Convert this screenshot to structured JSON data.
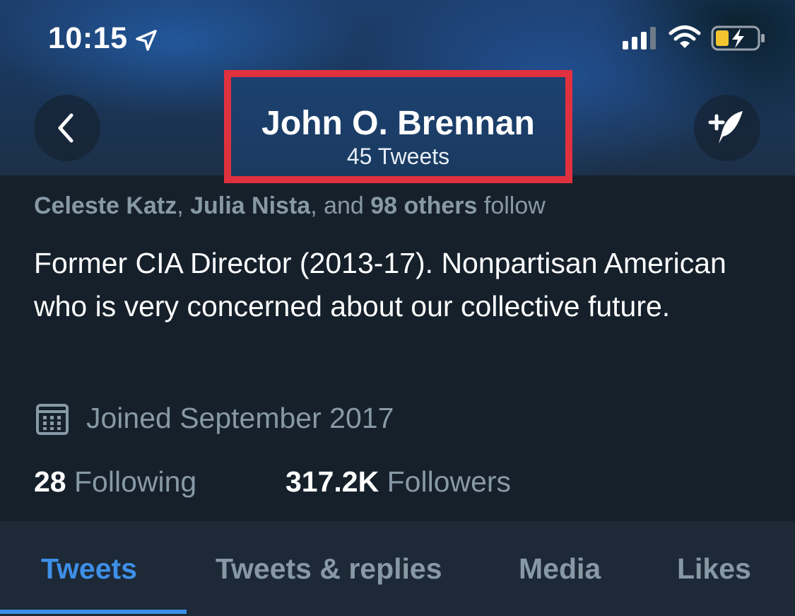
{
  "status_bar": {
    "time": "10:15",
    "icons": [
      "location-arrow-icon",
      "cellular-signal-icon",
      "wifi-icon",
      "battery-charging-icon"
    ]
  },
  "header": {
    "name": "John O. Brennan",
    "tweets_count": "45 Tweets",
    "back_icon": "chevron-left-icon",
    "compose_icon": "compose-tweet-icon",
    "highlight_color": "#e0313f"
  },
  "profile": {
    "followed_by": {
      "name1": "Celeste Katz",
      "sep1": ", ",
      "name2": "Julia Nista",
      "sep2": ", and ",
      "others": "98 others",
      "suffix": " follow"
    },
    "bio": "Former CIA Director (2013-17). Nonpartisan American who is very concerned about our collective future.",
    "joined": "Joined September 2017",
    "joined_icon": "calendar-icon",
    "following_count": "28",
    "following_label": "Following",
    "followers_count": "317.2K",
    "followers_label": "Followers"
  },
  "tabs": [
    {
      "label": "Tweets",
      "active": true
    },
    {
      "label": "Tweets & replies",
      "active": false
    },
    {
      "label": "Media",
      "active": false
    },
    {
      "label": "Likes",
      "active": false
    }
  ],
  "colors": {
    "background": "#15202b",
    "tabbar": "#1d2936",
    "accent": "#3e8fe8",
    "secondary_text": "#8899a6"
  }
}
